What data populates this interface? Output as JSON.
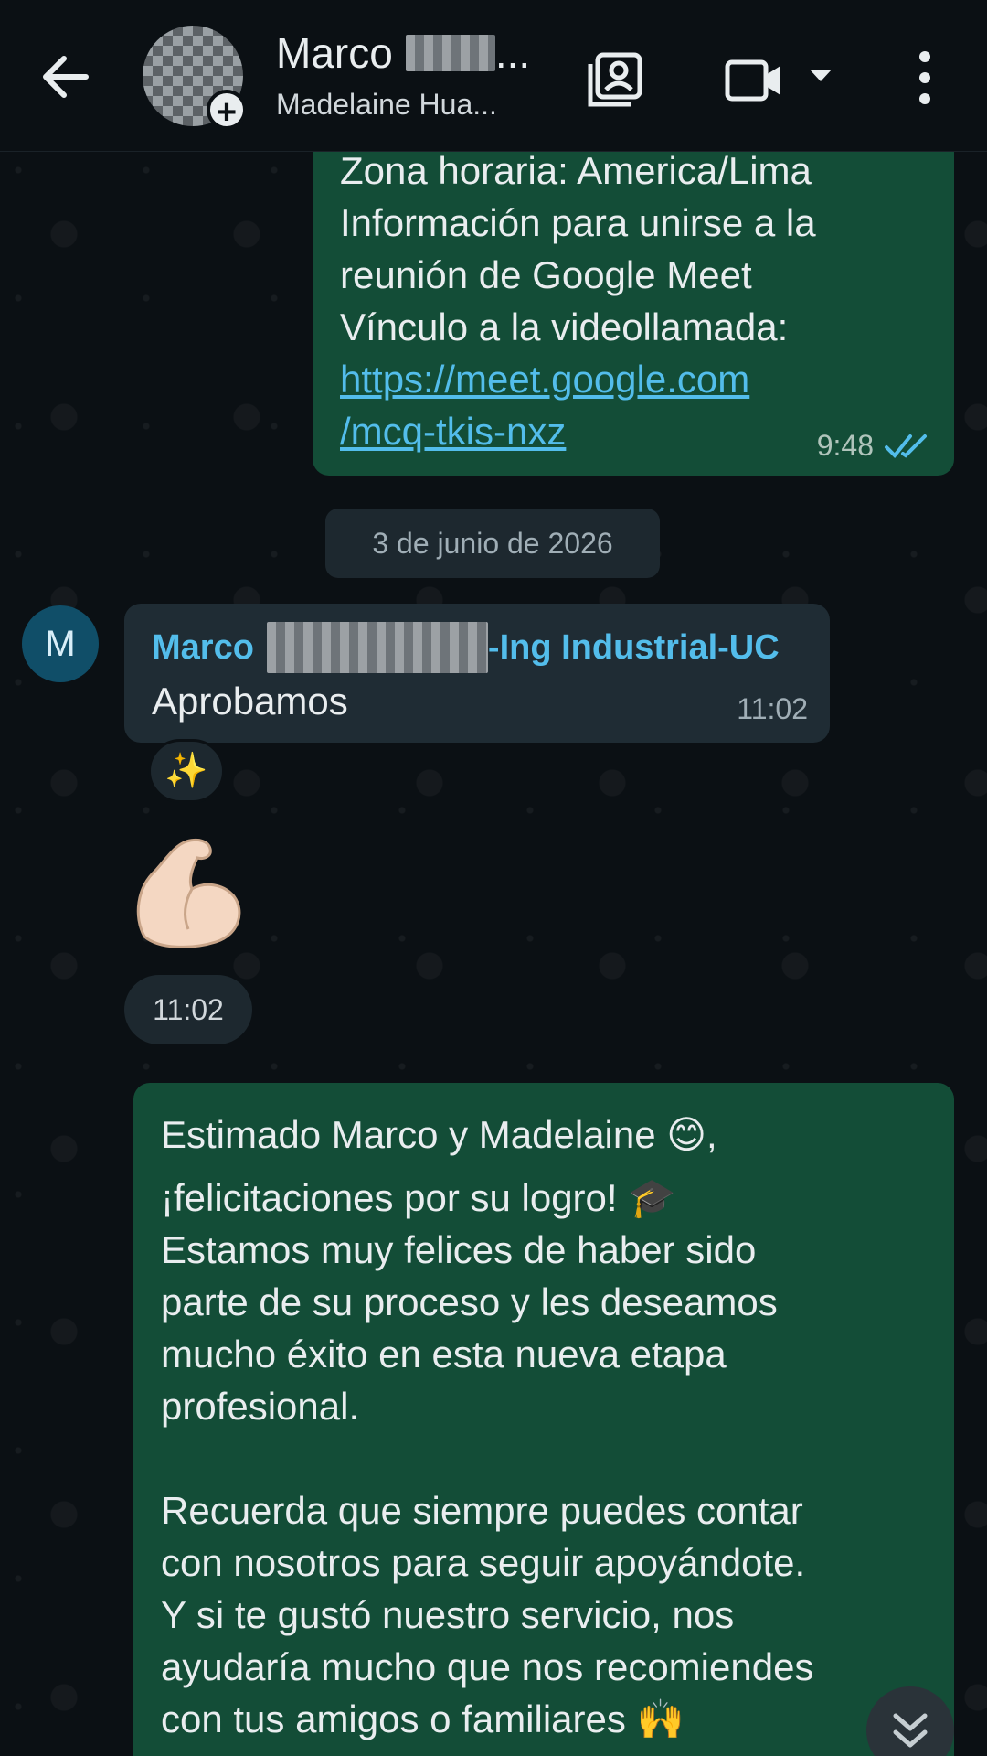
{
  "header": {
    "contact_name": "Marco",
    "name_suffix": "...",
    "subtitle": "Madelaine Hua...",
    "icons": [
      "back-arrow-icon",
      "contact-card-icon",
      "video-call-icon",
      "dropdown-caret-icon",
      "more-options-icon"
    ]
  },
  "messages": {
    "outgoing_top": {
      "lines": [
        "Zona horaria: America/Lima",
        "Información para unirse a la",
        "reunión de Google Meet",
        "Vínculo a la videollamada:"
      ],
      "link_line1": "https://meet.google.com",
      "link_line2": "/mcq-tkis-nxz",
      "time": "9:48",
      "status": "read"
    },
    "date_separator": "3 de junio de 2026",
    "incoming": {
      "avatar_letter": "M",
      "sender_first": "Marco",
      "sender_suffix": "-Ing Industrial-UC",
      "text": "Aprobamos",
      "time": "11:02",
      "reaction": "✨"
    },
    "incoming_emoji": {
      "emoji": "💪",
      "time": "11:02"
    },
    "outgoing_bottom": {
      "line1": "Estimado Marco y Madelaine 😊,",
      "line2": "¡felicitaciones por su logro! 🎓",
      "para1": [
        "Estamos muy felices de haber sido",
        "parte de su proceso y les deseamos",
        "mucho éxito en esta nueva etapa",
        "profesional."
      ],
      "para2": [
        "Recuerda que siempre puedes contar",
        "con nosotros para seguir apoyándote.",
        "Y si te gustó nuestro servicio, nos",
        "ayudaría mucho que nos recomiendes",
        "con tus amigos o familiares 🙌"
      ]
    }
  },
  "colors": {
    "outgoing_bubble": "#134d37",
    "incoming_bubble": "#1f2c34",
    "link": "#53bdeb",
    "read_ticks": "#53bdeb"
  }
}
